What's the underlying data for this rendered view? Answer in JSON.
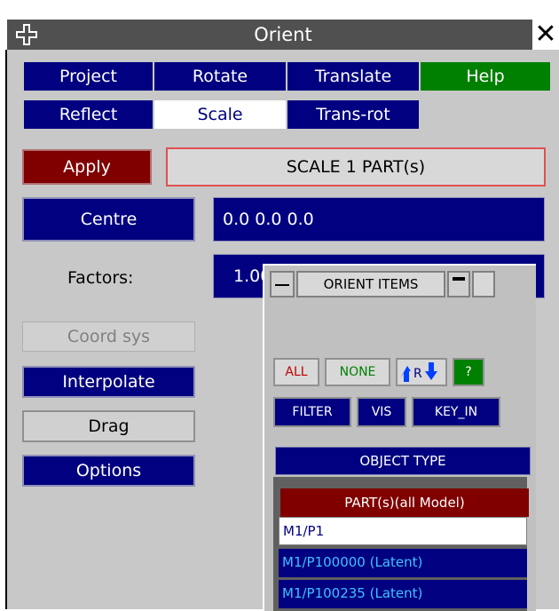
{
  "window": {
    "title": "Orient"
  },
  "tabs": [
    {
      "label": "Project"
    },
    {
      "label": "Rotate"
    },
    {
      "label": "Translate"
    },
    {
      "label": "Help"
    },
    {
      "label": "Reflect"
    },
    {
      "label": "Scale"
    },
    {
      "label": "Trans-rot"
    }
  ],
  "apply_label": "Apply",
  "status_text": "SCALE 1 PART(s)",
  "centre": {
    "label": "Centre",
    "value": "0.0  0.0  0.0"
  },
  "factors": {
    "label": "Factors:",
    "value": "1.000   1.000   1.000"
  },
  "side_buttons": {
    "coord_sys": "Coord sys",
    "interpolate": "Interpolate",
    "drag": "Drag",
    "options": "Options"
  },
  "orient_items": {
    "title": "ORIENT ITEMS",
    "all": "ALL",
    "none": "NONE",
    "swap_text": "R",
    "help": "?",
    "filter": "FILTER",
    "vis": "VIS",
    "key_in": "KEY_IN",
    "object_type": "OBJECT TYPE",
    "list_header": "PART(s)(all Model)",
    "rows": [
      {
        "text": "M1/P1"
      },
      {
        "text": "M1/P100000 (Latent)"
      },
      {
        "text": "M1/P100235 (Latent)"
      }
    ]
  },
  "colors": {
    "navy": "#000080",
    "help_green": "#008000",
    "apply_red": "#800000",
    "latent_text": "#40c0ff"
  },
  "icons": [
    "move-icon",
    "close-icon",
    "minimise-icon",
    "swap-arrows-icon"
  ]
}
